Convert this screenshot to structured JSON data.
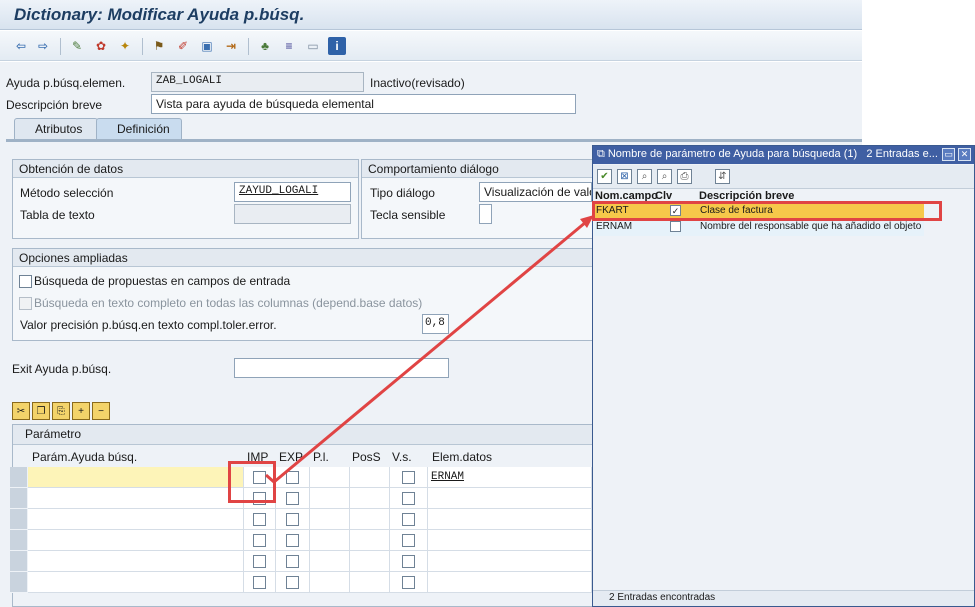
{
  "window": {
    "title": "Dictionary: Modificar Ayuda p.búsq."
  },
  "header": {
    "elementary_help_label": "Ayuda p.búsq.elemen.",
    "elementary_help_value": "ZAB_LOGALI",
    "status": "Inactivo(revisado)",
    "short_desc_label": "Descripción breve",
    "short_desc_value": "Vista para ayuda de búsqueda elemental"
  },
  "tabs": [
    {
      "label": "Atributos"
    },
    {
      "label": "Definición"
    }
  ],
  "data_group": {
    "title": "Obtención de datos",
    "method_label": "Método selección",
    "method_value": "ZAYUD_LOGALI",
    "text_table_label": "Tabla de texto"
  },
  "dialog_group": {
    "title": "Comportamiento diálogo",
    "type_label": "Tipo diálogo",
    "type_value": "Visualización de valo",
    "hotkey_label": "Tecla sensible"
  },
  "extended_group": {
    "title": "Opciones ampliadas",
    "opt1": "Búsqueda de propuestas en campos de entrada",
    "opt2": "Búsqueda en texto completo en todas las columnas (depend.base datos)",
    "precision_label": "Valor precisión p.búsq.en texto compl.toler.error.",
    "precision_value": "0,8"
  },
  "exit": {
    "label": "Exit Ayuda p.búsq."
  },
  "param_table": {
    "title": "Parámetro",
    "headers": [
      "Parám.Ayuda búsq.",
      "IMP",
      "EXP",
      "P.l.",
      "PosS",
      "V.s.",
      "Elem.datos"
    ],
    "row1_elem": "ERNAM"
  },
  "popup": {
    "title": "Nombre de parámetro de Ayuda para búsqueda (1)",
    "entries_header": "2 Entradas e...",
    "col_name": "Nom.campo",
    "col_key": "Clv",
    "col_desc": "Descripción breve",
    "rows": [
      {
        "name": "FKART",
        "desc": "Clase de factura"
      },
      {
        "name": "ERNAM",
        "desc": "Nombre del responsable que ha añadido el objeto"
      }
    ],
    "footer": "2 Entradas encontradas"
  },
  "colors": {
    "highlight": "#f6c84a",
    "popup_title": "#3f5fa3",
    "annotation_red": "#e04444"
  }
}
